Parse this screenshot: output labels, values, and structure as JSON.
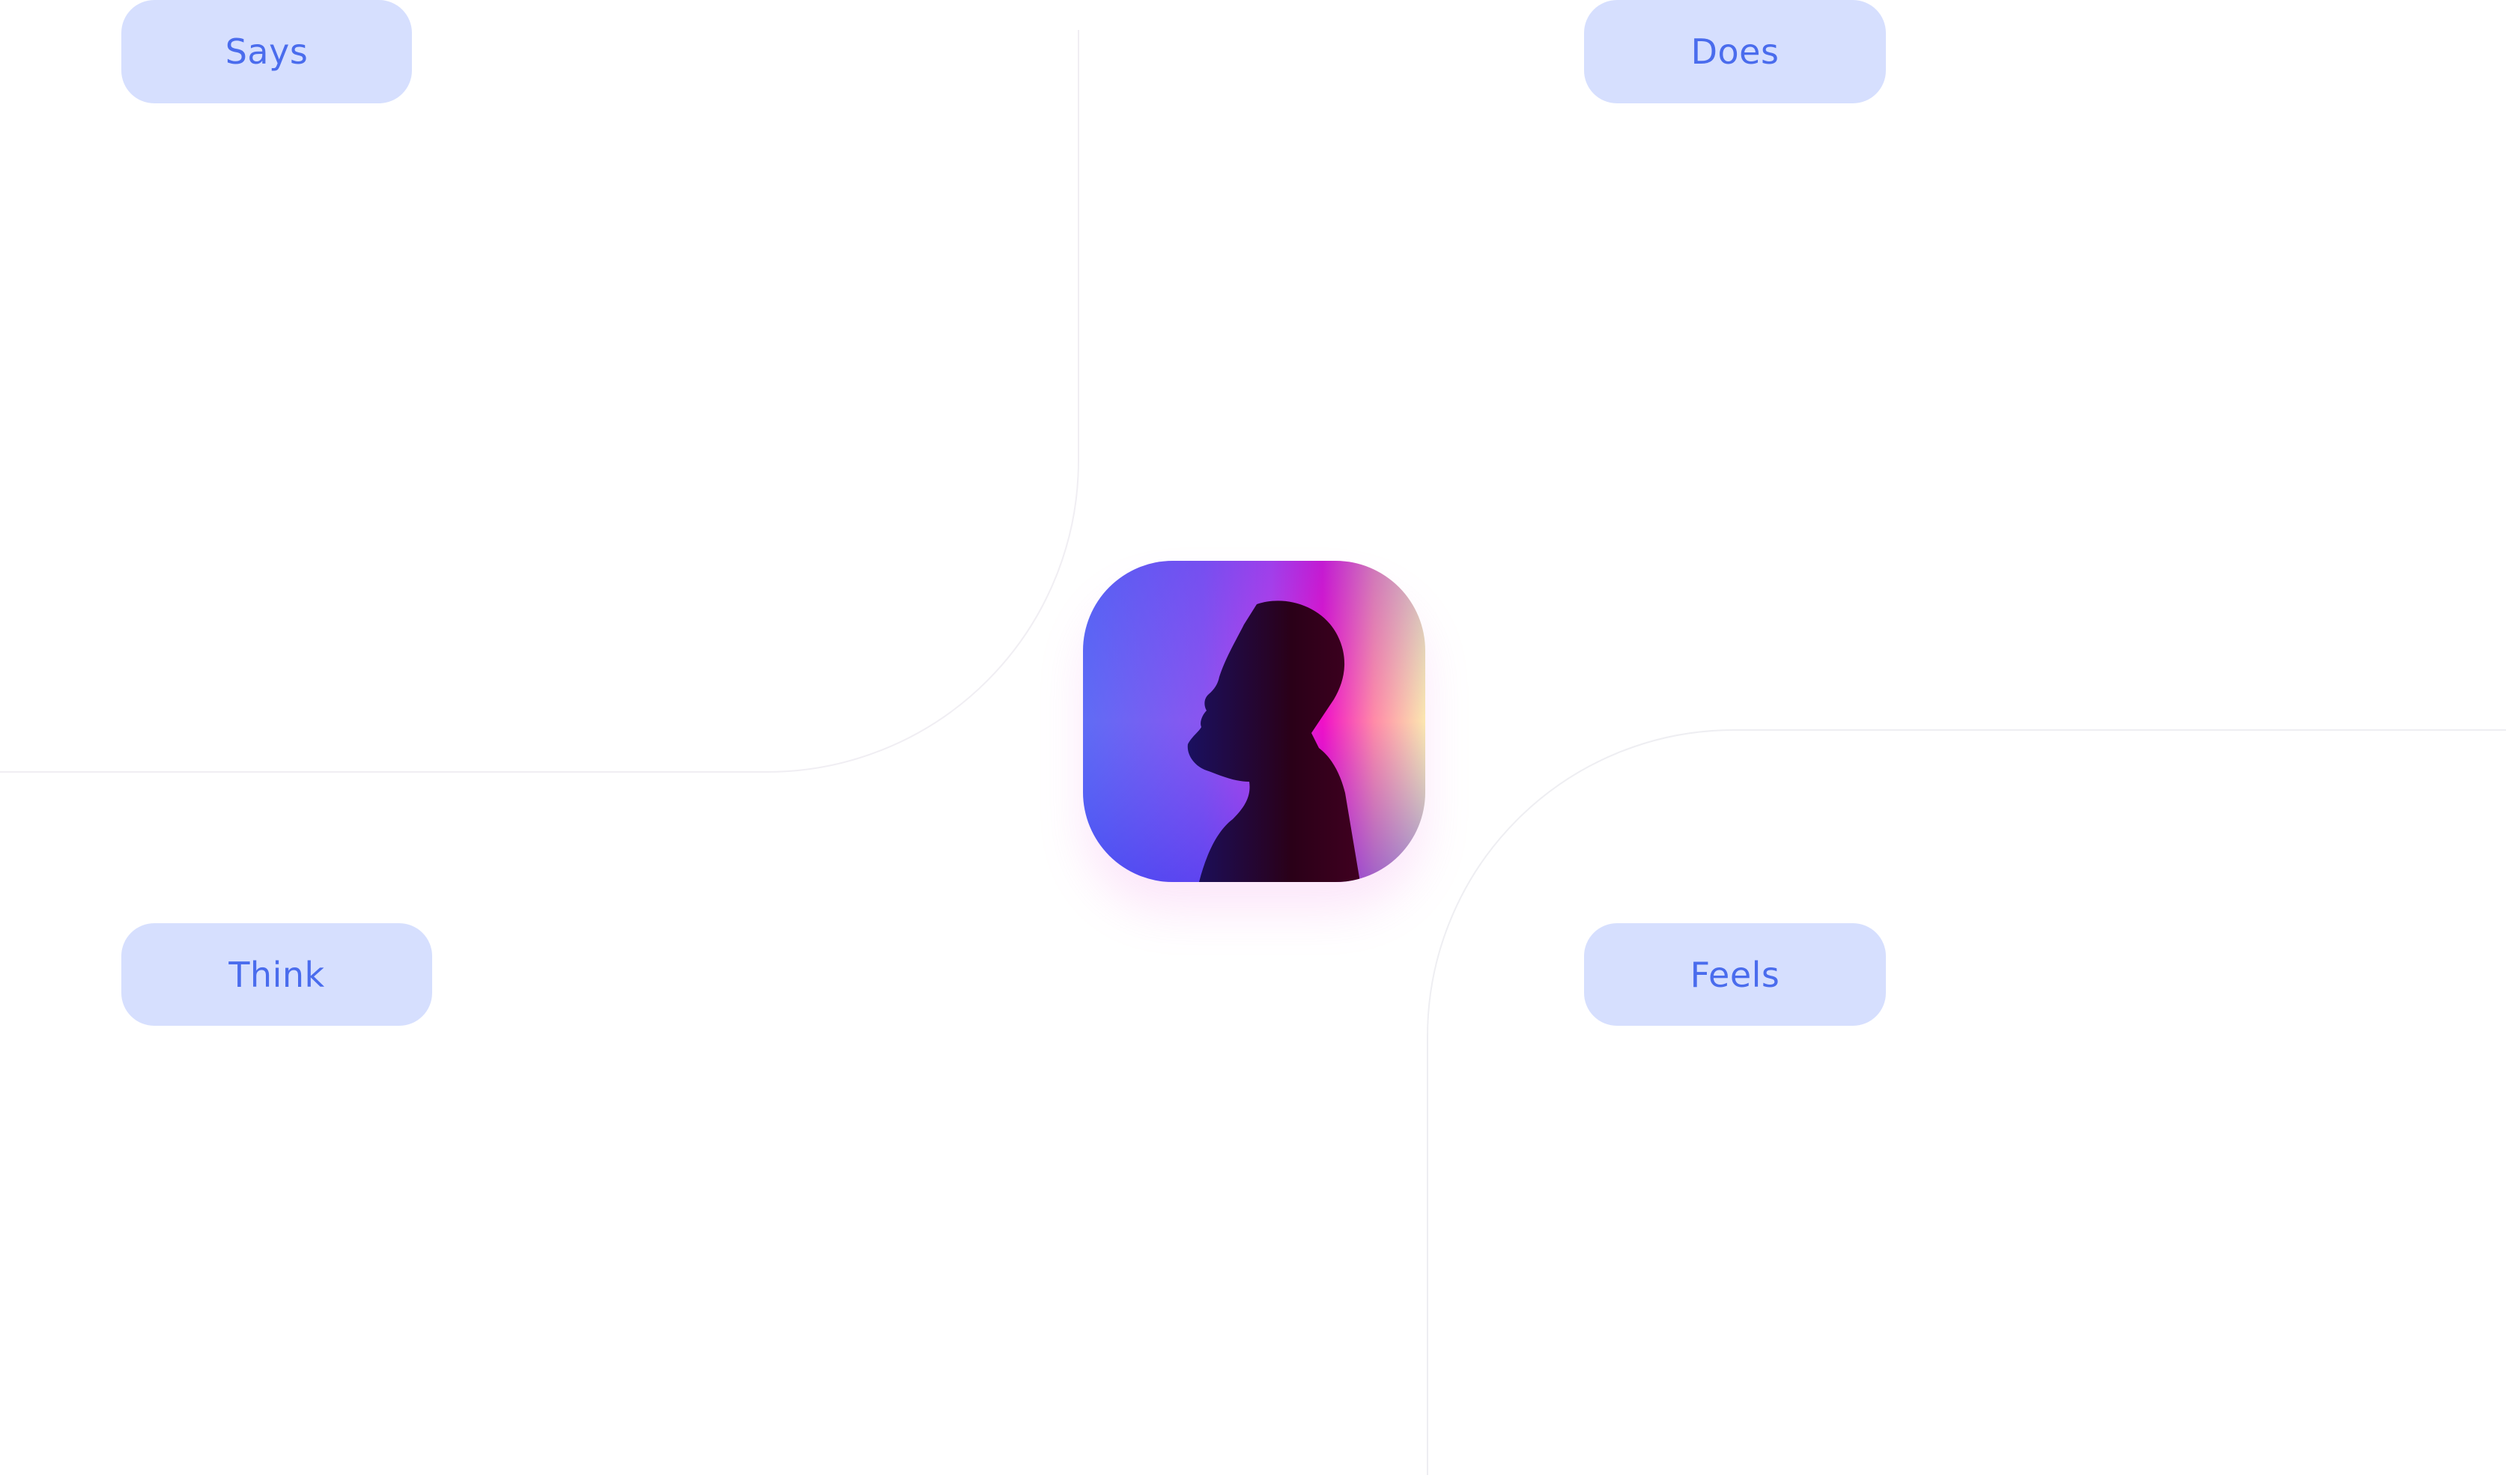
{
  "quadrants": {
    "says": "Says",
    "does": "Does",
    "think": "Think",
    "feels": "Feels"
  },
  "colors": {
    "pill_bg": "#d6dffe",
    "pill_text": "#4a6ced",
    "divider": "#eeeef2"
  },
  "center": {
    "avatar_icon": "person-profile-photo"
  }
}
